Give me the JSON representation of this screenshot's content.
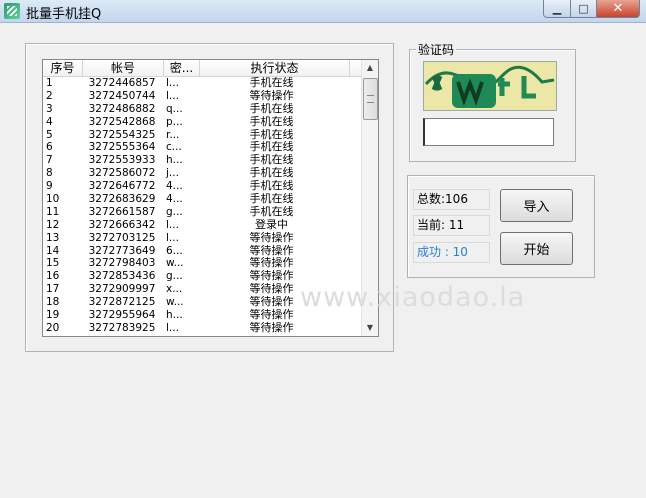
{
  "window": {
    "title": "批量手机挂Q",
    "min_glyph": "▁",
    "max_glyph": "□",
    "close_glyph": "✕",
    "app_icon": "app-icon"
  },
  "list": {
    "columns": [
      "序号",
      "帐号",
      "密...",
      "执行状态"
    ],
    "rows": [
      [
        "1",
        "3272446857",
        "l...",
        "手机在线"
      ],
      [
        "2",
        "3272450744",
        "l...",
        "等待操作"
      ],
      [
        "3",
        "3272486882",
        "q...",
        "手机在线"
      ],
      [
        "4",
        "3272542868",
        "p...",
        "手机在线"
      ],
      [
        "5",
        "3272554325",
        "r...",
        "手机在线"
      ],
      [
        "6",
        "3272555364",
        "c...",
        "手机在线"
      ],
      [
        "7",
        "3272553933",
        "h...",
        "手机在线"
      ],
      [
        "8",
        "3272586072",
        "j...",
        "手机在线"
      ],
      [
        "9",
        "3272646772",
        "4...",
        "手机在线"
      ],
      [
        "10",
        "3272683629",
        "4...",
        "手机在线"
      ],
      [
        "11",
        "3272661587",
        "g...",
        "手机在线"
      ],
      [
        "12",
        "3272666342",
        "l...",
        "登录中"
      ],
      [
        "13",
        "3272703125",
        "l...",
        "等待操作"
      ],
      [
        "14",
        "3272773649",
        "6...",
        "等待操作"
      ],
      [
        "15",
        "3272798403",
        "w...",
        "等待操作"
      ],
      [
        "16",
        "3272853436",
        "g...",
        "等待操作"
      ],
      [
        "17",
        "3272909997",
        "x...",
        "等待操作"
      ],
      [
        "18",
        "3272872125",
        "w...",
        "等待操作"
      ],
      [
        "19",
        "3272955964",
        "h...",
        "等待操作"
      ],
      [
        "20",
        "3272783925",
        "l...",
        "等待操作"
      ]
    ]
  },
  "captcha": {
    "legend": "验证码",
    "input_value": ""
  },
  "stats": {
    "total": "总数:106",
    "current": "当前: 11",
    "success": "成功 : 10",
    "success_color": "#2a7fd4"
  },
  "buttons": {
    "import": "导入",
    "start": "开始"
  },
  "watermark": "www.xiaodao.la"
}
